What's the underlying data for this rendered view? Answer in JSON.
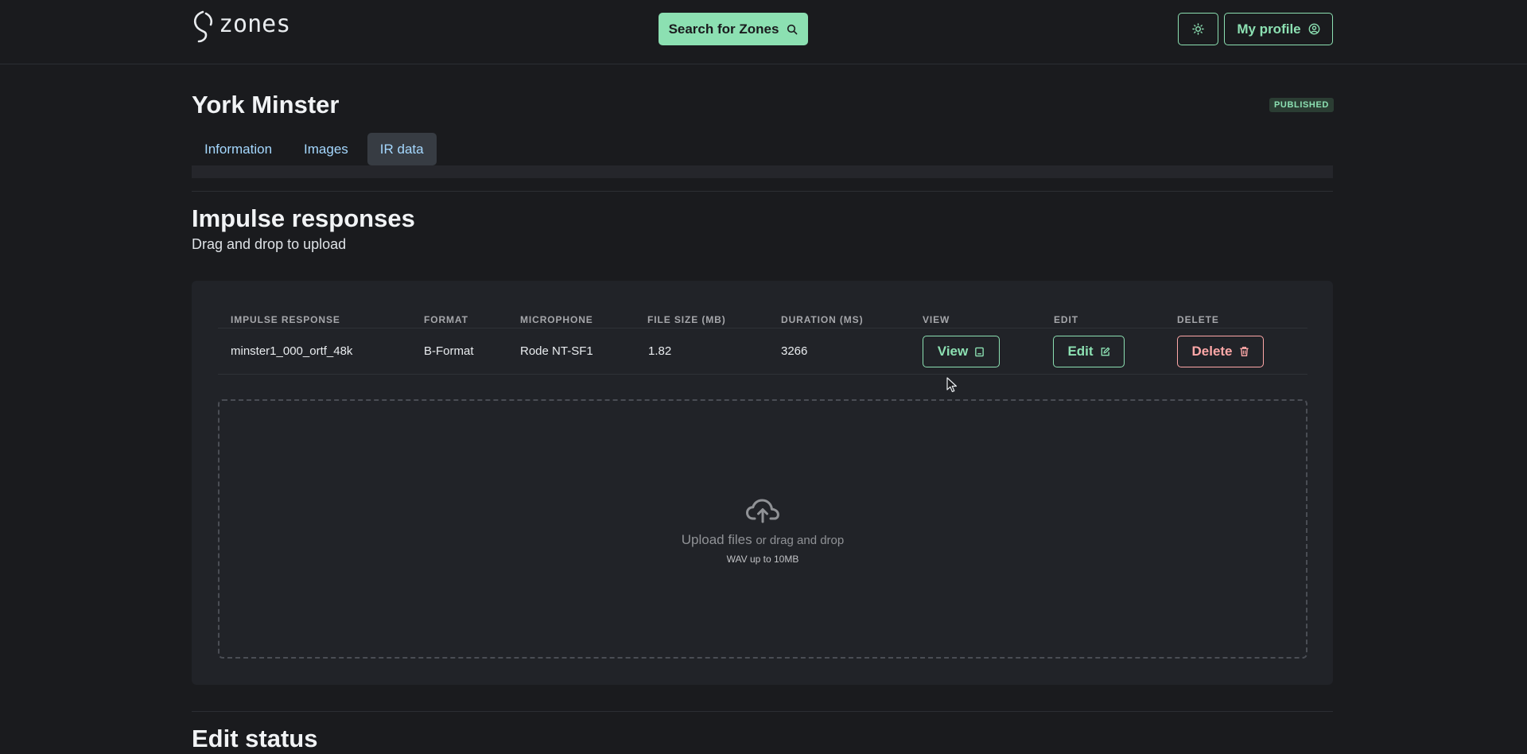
{
  "header": {
    "logo_text": "zones",
    "search_label": "Search for Zones",
    "profile_label": "My profile",
    "icons": [
      "search-icon",
      "sun-icon",
      "user-circle-icon"
    ]
  },
  "page": {
    "title": "York Minster",
    "status_badge": "PUBLISHED",
    "tabs": [
      {
        "label": "Information",
        "active": false
      },
      {
        "label": "Images",
        "active": false
      },
      {
        "label": "IR data",
        "active": true
      }
    ]
  },
  "impulse_section": {
    "title": "Impulse responses",
    "subtitle": "Drag and drop to upload",
    "columns": [
      "IMPULSE RESPONSE",
      "FORMAT",
      "MICROPHONE",
      "FILE SIZE (MB)",
      "DURATION (MS)",
      "VIEW",
      "EDIT",
      "DELETE"
    ],
    "rows": [
      {
        "impulse_response": "minster1_000_ortf_48k",
        "format": "B-Format",
        "microphone": "Rode NT-SF1",
        "file_size_mb": "1.82",
        "duration_ms": "3266",
        "view_label": "View",
        "edit_label": "Edit",
        "delete_label": "Delete"
      }
    ],
    "dropzone": {
      "upload_label": "Upload files",
      "or_drag_label": "or drag and drop",
      "hint": "WAV up to 10MB",
      "icon": "cloud-upload-icon"
    }
  },
  "edit_status_section": {
    "title": "Edit status"
  },
  "colors": {
    "background": "#1a1b1e",
    "accent": "#8ce0b2",
    "danger": "#ffa8a8",
    "tab_text": "#a5d8ff",
    "card": "#212328"
  }
}
